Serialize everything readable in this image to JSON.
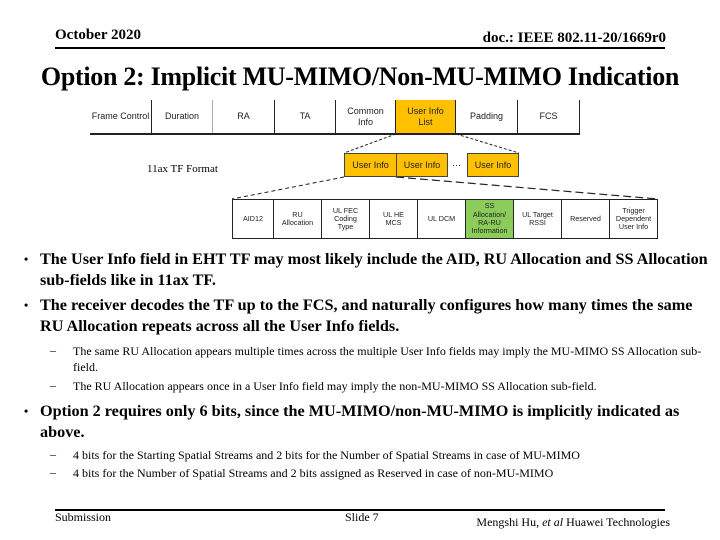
{
  "header": {
    "date": "October 2020",
    "doc_id": "doc.: IEEE 802.11-20/1669r0"
  },
  "title": "Option 2: Implicit MU-MIMO/Non-MU-MIMO Indication",
  "diagram": {
    "colors": {
      "highlight_orange": "#ffc000",
      "highlight_green": "#8ccc5a"
    },
    "frame_fields": [
      {
        "label": "Frame Control"
      },
      {
        "label": "Duration"
      },
      {
        "label": "RA"
      },
      {
        "label": "TA"
      },
      {
        "label": "Common Info"
      },
      {
        "label": "User Info List",
        "highlight": "orange"
      },
      {
        "label": "Padding"
      },
      {
        "label": "FCS"
      }
    ],
    "user_info_list": [
      "User Info",
      "User Info",
      "User Info"
    ],
    "ellipsis": "···",
    "format_label": "11ax TF Format",
    "user_info_fields": [
      {
        "label": "AID12"
      },
      {
        "label": "RU Allocation"
      },
      {
        "label": "UL FEC Coding Type"
      },
      {
        "label": "UL HE MCS"
      },
      {
        "label": "UL DCM"
      },
      {
        "label": "SS Allocation/ RA-RU Information",
        "highlight": "green"
      },
      {
        "label": "UL Target RSSI"
      },
      {
        "label": "Reserved"
      },
      {
        "label": "Trigger Dependent User Info"
      }
    ]
  },
  "bullets": [
    {
      "text": "The User Info field in EHT TF may most likely include the AID, RU Allocation and SS Allocation sub-fields like in 11ax TF."
    },
    {
      "text": "The receiver decodes the TF up to the FCS, and naturally configures how many times the same RU Allocation repeats across all the User Info fields.",
      "sub": [
        "The same RU Allocation appears multiple times across the multiple User Info fields may imply the MU-MIMO SS Allocation sub-field.",
        "The RU Allocation appears once in a User Info field may imply the non-MU-MIMO SS Allocation sub-field."
      ]
    },
    {
      "text": "Option 2 requires only 6 bits, since the MU-MIMO/non-MU-MIMO is implicitly indicated as above.",
      "sub": [
        "4 bits for the Starting Spatial Streams and  2 bits for the Number of Spatial Streams in case of MU-MIMO",
        "4 bits for the Number of Spatial Streams and 2 bits assigned as Reserved in case of non-MU-MIMO"
      ]
    }
  ],
  "bullet_glyph": "•",
  "dash_glyph": "–",
  "footer": {
    "left": "Submission",
    "center": "Slide 7",
    "author": "Mengshi Hu, ",
    "etal": "et al",
    "org": " Huawei Technologies"
  }
}
